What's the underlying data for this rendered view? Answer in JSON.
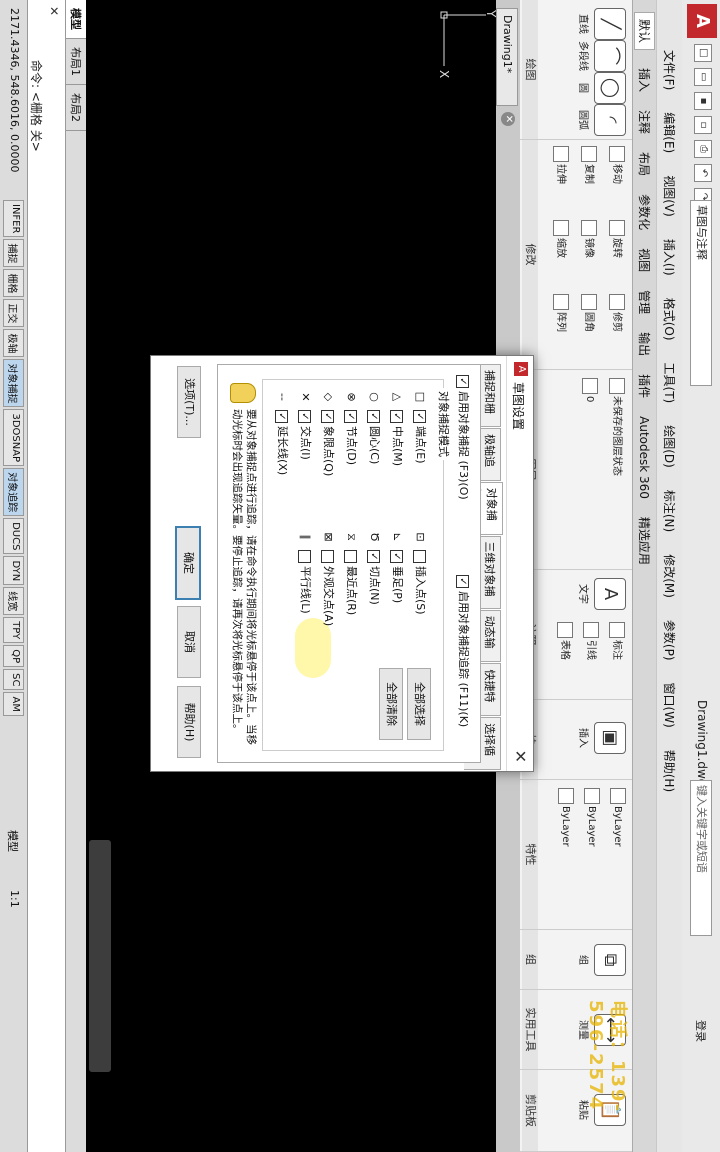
{
  "app": {
    "title": "Drawing1.dwg",
    "workspace": "草图与注释",
    "search_placeholder": "键入关键字或短语",
    "signin": "登录",
    "logo": "A"
  },
  "menubar": [
    "文件(F)",
    "编辑(E)",
    "视图(V)",
    "插入(I)",
    "格式(O)",
    "工具(T)",
    "绘图(D)",
    "标注(N)",
    "修改(M)",
    "参数(P)",
    "窗口(W)",
    "帮助(H)"
  ],
  "ribbon_tabs": [
    "默认",
    "插入",
    "注释",
    "布局",
    "参数化",
    "视图",
    "管理",
    "输出",
    "插件",
    "Autodesk 360",
    "精选应用"
  ],
  "ribbon": {
    "draw": {
      "title": "绘图",
      "line": "直线",
      "polyline": "多段线",
      "circle": "圆",
      "arc": "圆弧"
    },
    "modify": {
      "title": "修改",
      "move": "移动",
      "rotate": "旋转",
      "trim": "修剪",
      "copy": "复制",
      "mirror": "镜像",
      "fillet": "圆角",
      "stretch": "拉伸",
      "scale": "缩放",
      "array": "阵列"
    },
    "layers": {
      "title": "图层",
      "state": "未保存的图层状态",
      "layer0": "0"
    },
    "annotation": {
      "title": "注释",
      "text": "文字",
      "dimension": "标注",
      "leader": "引线",
      "table": "表格"
    },
    "block": {
      "title": "块",
      "insert": "插入"
    },
    "properties": {
      "title": "特性",
      "bylayer1": "ByLayer",
      "bylayer2": "ByLayer",
      "bylayer3": "ByLayer"
    },
    "groups": {
      "title": "组",
      "group": "组"
    },
    "utilities": {
      "title": "实用工具",
      "measure": "测量"
    },
    "clipboard": {
      "title": "剪贴板",
      "paste": "粘贴"
    }
  },
  "file_tab": "Drawing1*",
  "layout_tabs": [
    "模型",
    "布局1",
    "布局2"
  ],
  "command": {
    "close": "✕",
    "prompt": "命令: <栅格 关>"
  },
  "status": {
    "coords": "2171.4346, 548.6016, 0.0000",
    "toggles": [
      {
        "label": "INFER",
        "on": false
      },
      {
        "label": "捕捉",
        "on": false
      },
      {
        "label": "栅格",
        "on": false
      },
      {
        "label": "正交",
        "on": false
      },
      {
        "label": "极轴",
        "on": false
      },
      {
        "label": "对象捕捉",
        "on": true
      },
      {
        "label": "3DOSNAP",
        "on": false
      },
      {
        "label": "对象追踪",
        "on": true
      },
      {
        "label": "DUCS",
        "on": false
      },
      {
        "label": "DYN",
        "on": false
      },
      {
        "label": "线宽",
        "on": false
      },
      {
        "label": "TPY",
        "on": false
      },
      {
        "label": "QP",
        "on": false
      },
      {
        "label": "SC",
        "on": false
      },
      {
        "label": "AM",
        "on": false
      }
    ],
    "model": "模型",
    "scale": "1:1"
  },
  "watermark": "电话：139-596-2574",
  "dialog": {
    "title": "草图设置",
    "close": "✕",
    "tabs": [
      "捕捉和栅格",
      "极轴追踪",
      "对象捕捉",
      "三维对象捕捉",
      "动态输入",
      "快捷特性",
      "选择循环"
    ],
    "enable_osnap": "启用对象捕捉 (F3)(O)",
    "enable_track": "启用对象捕捉追踪 (F11)(K)",
    "group_label": "对象捕捉模式",
    "left_modes": [
      {
        "sym": "□",
        "label": "端点(E)",
        "checked": true
      },
      {
        "sym": "△",
        "label": "中点(M)",
        "checked": true
      },
      {
        "sym": "○",
        "label": "圆心(C)",
        "checked": true
      },
      {
        "sym": "⊗",
        "label": "节点(D)",
        "checked": true
      },
      {
        "sym": "◇",
        "label": "象限点(Q)",
        "checked": true
      },
      {
        "sym": "✕",
        "label": "交点(I)",
        "checked": true
      },
      {
        "sym": "--",
        "label": "延长线(X)",
        "checked": true
      }
    ],
    "right_modes": [
      {
        "sym": "⊡",
        "label": "插入点(S)",
        "checked": false
      },
      {
        "sym": "⊾",
        "label": "垂足(P)",
        "checked": true
      },
      {
        "sym": "Ծ",
        "label": "切点(N)",
        "checked": true
      },
      {
        "sym": "⧖",
        "label": "最近点(R)",
        "checked": false
      },
      {
        "sym": "⊠",
        "label": "外观交点(A)",
        "checked": false
      },
      {
        "sym": "∥",
        "label": "平行线(L)",
        "checked": false
      }
    ],
    "select_all": "全部选择",
    "clear_all": "全部清除",
    "hint": "要从对象捕捉点进行追踪，请在命令执行期间将光标悬停于该点上。当移动光标时会出现追踪矢量。要停止追踪，请再次将光标悬停于该点上。",
    "options": "选项(T)...",
    "ok": "确定",
    "cancel": "取消",
    "help": "帮助(H)"
  }
}
